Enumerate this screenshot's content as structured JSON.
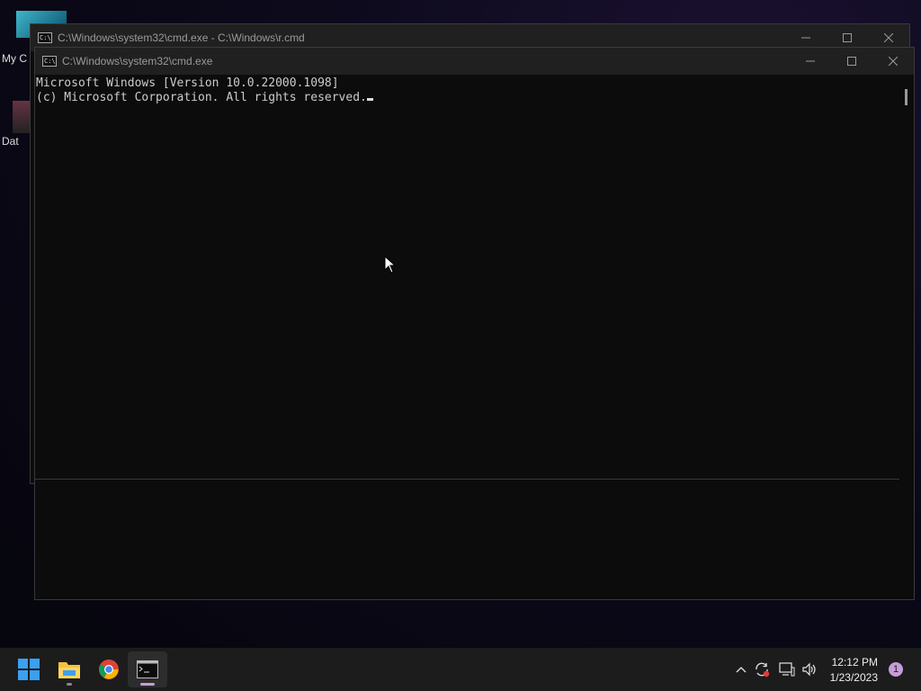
{
  "desktop": {
    "icon1_label": "My C",
    "icon2_label": "Dat"
  },
  "back_window": {
    "title": "C:\\Windows\\system32\\cmd.exe - C:\\Windows\\r.cmd"
  },
  "front_window": {
    "title": "C:\\Windows\\system32\\cmd.exe",
    "console_lines": [
      "Microsoft Windows [Version 10.0.22000.1098]",
      "(c) Microsoft Corporation. All rights reserved."
    ]
  },
  "taskbar": {
    "apps": [
      "start-icon",
      "file-explorer-icon",
      "chrome-icon",
      "terminal-icon"
    ],
    "time": "12:12 PM",
    "date": "1/23/2023",
    "notification_count": "1"
  },
  "colors": {
    "console_bg": "#0c0c0c",
    "console_fg": "#cccccc",
    "titlebar_bg": "#202020",
    "taskbar_bg": "#1c1c1c",
    "accent": "#c59cd8"
  }
}
